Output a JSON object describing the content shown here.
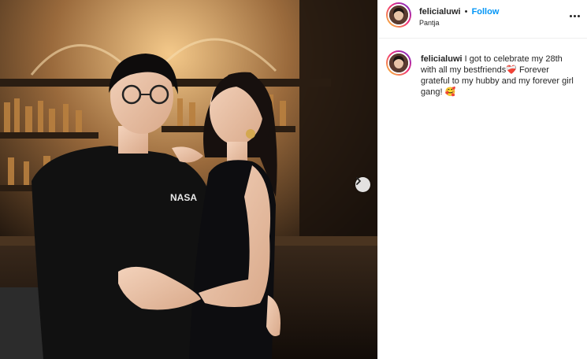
{
  "post": {
    "username": "felicialuwi",
    "separator": "•",
    "follow_label": "Follow",
    "location": "Pantja"
  },
  "caption": {
    "username": "felicialuwi",
    "text": "I got to celebrate my 28th with all my bestfriends❤️‍🩹 Forever grateful to my hubby and my forever girl gang! 🥰"
  },
  "photo": {
    "shirt_print": "NASA"
  },
  "icons": {
    "next": "chevron-right-icon",
    "more": "more-options-icon"
  },
  "colors": {
    "accent": "#0095f6",
    "story_ring_start": "#f9ce34",
    "story_ring_end": "#6228d7"
  }
}
